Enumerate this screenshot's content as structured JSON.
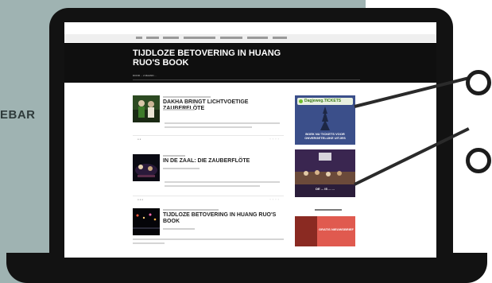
{
  "backdrop": {
    "side_label": "EBAR"
  },
  "site": {
    "hero": {
      "title": "TIJDLOZE BETOVERING IN HUANG RUO'S BOOK",
      "meta": "DOOR ... 2 MAAND ..."
    },
    "posts": [
      {
        "title": "DAKHA BRINGT LICHTVOETIGE ZAUBERFLÖTE",
        "thumb": "opera-performers-photo"
      },
      {
        "title": "IN DE ZAAL: DIE ZAUBERFLÖTE",
        "thumb": "opera-stage-photo"
      },
      {
        "title": "TIJDLOZE BETOVERING IN HUANG RUO'S BOOK",
        "thumb": "dark-stage-lights-photo"
      }
    ],
    "sidebar": {
      "ad1": {
        "brand": "Dagjeweg.TICKETS",
        "text": "BOEK NU TICKETS VOOR ONVERGETELIJKE UITJES"
      },
      "ad2": {
        "text": "DE ... IS ... ..."
      },
      "ad3": {
        "text": "GRATIS NIEUWSBRIEF"
      }
    }
  },
  "colors": {
    "backdrop": "#9fb3b2",
    "laptop": "#121212",
    "accent_green": "#6fbf2d"
  }
}
